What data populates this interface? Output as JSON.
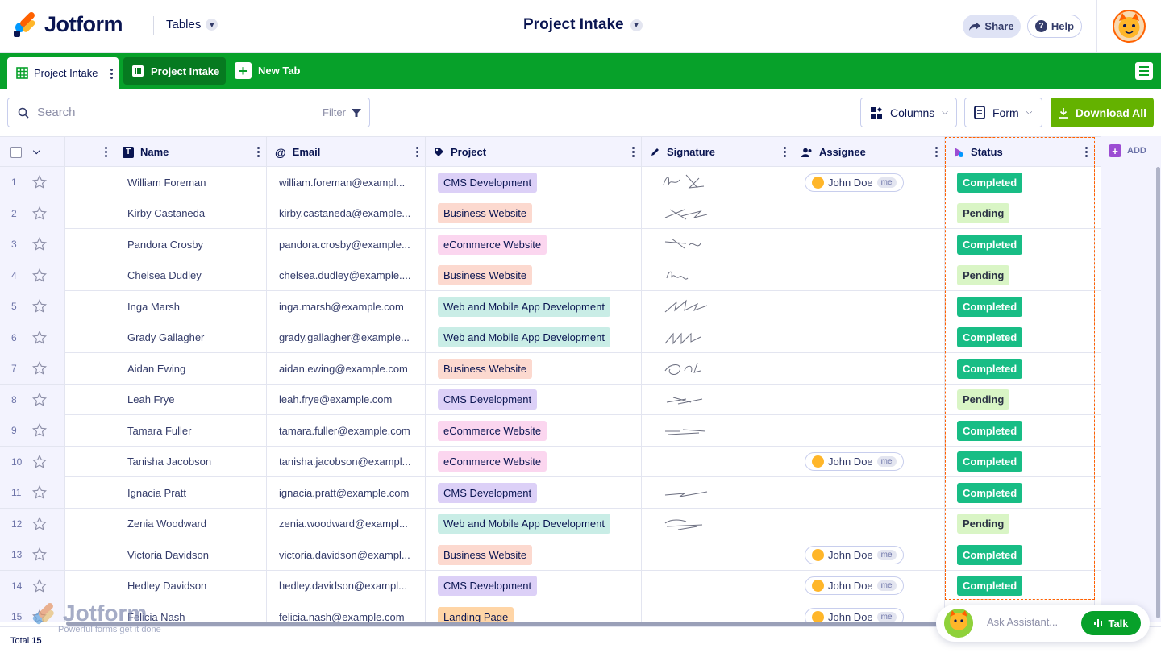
{
  "header": {
    "brand": "Jotform",
    "tables_label": "Tables",
    "title": "Project Intake",
    "share_label": "Share",
    "help_label": "Help"
  },
  "tabs": {
    "active_label": "Project Intake",
    "second_label": "Project Intake",
    "new_label": "New Tab"
  },
  "toolbar": {
    "search_placeholder": "Search",
    "filter_label": "Filter",
    "columns_label": "Columns",
    "form_label": "Form",
    "download_label": "Download All"
  },
  "columns": {
    "name": "Name",
    "email": "Email",
    "project": "Project",
    "signature": "Signature",
    "assignee": "Assignee",
    "status": "Status",
    "add": "ADD"
  },
  "colors": {
    "brand_green": "#07a12a",
    "download_green": "#64b200",
    "completed": "#18bd85",
    "pending": "#d9f5c5",
    "highlight": "#ff6100"
  },
  "rows": [
    {
      "num": "1",
      "name": "William Foreman",
      "email": "william.foreman@exampl...",
      "project": "CMS Development",
      "assignee": "John Doe",
      "status": "Completed"
    },
    {
      "num": "2",
      "name": "Kirby Castaneda",
      "email": "kirby.castaneda@example...",
      "project": "Business Website",
      "assignee": "",
      "status": "Pending"
    },
    {
      "num": "3",
      "name": "Pandora Crosby",
      "email": "pandora.crosby@example...",
      "project": "eCommerce Website",
      "assignee": "",
      "status": "Completed"
    },
    {
      "num": "4",
      "name": "Chelsea Dudley",
      "email": "chelsea.dudley@example....",
      "project": "Business Website",
      "assignee": "",
      "status": "Pending"
    },
    {
      "num": "5",
      "name": "Inga Marsh",
      "email": "inga.marsh@example.com",
      "project": "Web and Mobile App Development",
      "assignee": "",
      "status": "Completed"
    },
    {
      "num": "6",
      "name": "Grady Gallagher",
      "email": "grady.gallagher@example...",
      "project": "Web and Mobile App Development",
      "assignee": "",
      "status": "Completed"
    },
    {
      "num": "7",
      "name": "Aidan Ewing",
      "email": "aidan.ewing@example.com",
      "project": "Business Website",
      "assignee": "",
      "status": "Completed"
    },
    {
      "num": "8",
      "name": "Leah Frye",
      "email": "leah.frye@example.com",
      "project": "CMS Development",
      "assignee": "",
      "status": "Pending"
    },
    {
      "num": "9",
      "name": "Tamara Fuller",
      "email": "tamara.fuller@example.com",
      "project": "eCommerce Website",
      "assignee": "",
      "status": "Completed"
    },
    {
      "num": "10",
      "name": "Tanisha Jacobson",
      "email": "tanisha.jacobson@exampl...",
      "project": "eCommerce Website",
      "assignee": "John Doe",
      "status": "Completed"
    },
    {
      "num": "11",
      "name": "Ignacia Pratt",
      "email": "ignacia.pratt@example.com",
      "project": "CMS Development",
      "assignee": "",
      "status": "Completed"
    },
    {
      "num": "12",
      "name": "Zenia Woodward",
      "email": "zenia.woodward@exampl...",
      "project": "Web and Mobile App Development",
      "assignee": "",
      "status": "Pending"
    },
    {
      "num": "13",
      "name": "Victoria Davidson",
      "email": "victoria.davidson@exampl...",
      "project": "Business Website",
      "assignee": "John Doe",
      "status": "Completed"
    },
    {
      "num": "14",
      "name": "Hedley Davidson",
      "email": "hedley.davidson@exampl...",
      "project": "CMS Development",
      "assignee": "John Doe",
      "status": "Completed"
    },
    {
      "num": "15",
      "name": "Felicia Nash",
      "email": "felicia.nash@example.com",
      "project": "Landing Page",
      "assignee": "John Doe",
      "status": ""
    }
  ],
  "assignee_badge": "me",
  "footer": {
    "total_label": "Total",
    "total_count": "15",
    "watermark_brand": "Jotform",
    "watermark_tagline": "Powerful forms get it done"
  },
  "assistant": {
    "placeholder": "Ask Assistant...",
    "talk_label": "Talk"
  }
}
